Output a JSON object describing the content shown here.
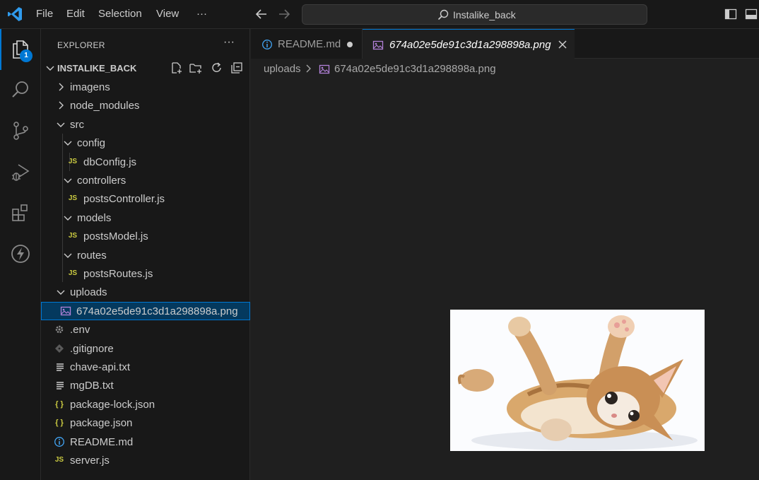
{
  "menu": {
    "file": "File",
    "edit": "Edit",
    "selection": "Selection",
    "view": "View",
    "more": "···"
  },
  "search": {
    "text": "Instalike_back"
  },
  "activity": {
    "explorer_badge": "1"
  },
  "explorer": {
    "title": "EXPLORER",
    "more": "···",
    "project": "INSTALIKE_BACK",
    "items": [
      {
        "label": "imagens",
        "kind": "folder",
        "state": "collapsed"
      },
      {
        "label": "node_modules",
        "kind": "folder",
        "state": "collapsed"
      },
      {
        "label": "src",
        "kind": "folder",
        "state": "expanded"
      },
      {
        "label": "config",
        "kind": "folder",
        "state": "expanded"
      },
      {
        "label": "dbConfig.js",
        "kind": "js",
        "icon": "JS"
      },
      {
        "label": "controllers",
        "kind": "folder",
        "state": "expanded"
      },
      {
        "label": "postsController.js",
        "kind": "js",
        "icon": "JS"
      },
      {
        "label": "models",
        "kind": "folder",
        "state": "expanded"
      },
      {
        "label": "postsModel.js",
        "kind": "js",
        "icon": "JS"
      },
      {
        "label": "routes",
        "kind": "folder",
        "state": "expanded"
      },
      {
        "label": "postsRoutes.js",
        "kind": "js",
        "icon": "JS"
      },
      {
        "label": "uploads",
        "kind": "folder",
        "state": "expanded"
      },
      {
        "label": "674a02e5de91c3d1a298898a.png",
        "kind": "image",
        "selected": true
      },
      {
        "label": ".env",
        "kind": "env"
      },
      {
        "label": ".gitignore",
        "kind": "git"
      },
      {
        "label": "chave-api.txt",
        "kind": "txt"
      },
      {
        "label": "mgDB.txt",
        "kind": "txt"
      },
      {
        "label": "package-lock.json",
        "kind": "json",
        "icon": "{ }"
      },
      {
        "label": "package.json",
        "kind": "json",
        "icon": "{ }"
      },
      {
        "label": "README.md",
        "kind": "info"
      },
      {
        "label": "server.js",
        "kind": "js",
        "icon": "JS"
      }
    ]
  },
  "tabs": [
    {
      "label": "README.md",
      "state": "modified"
    },
    {
      "label": "674a02e5de91c3d1a298898a.png",
      "state": "active"
    }
  ],
  "breadcrumb": {
    "folder": "uploads",
    "file": "674a02e5de91c3d1a298898a.png"
  },
  "colors": {
    "accent": "#0078d4",
    "selection": "#04395e",
    "js": "#cbcb41"
  }
}
